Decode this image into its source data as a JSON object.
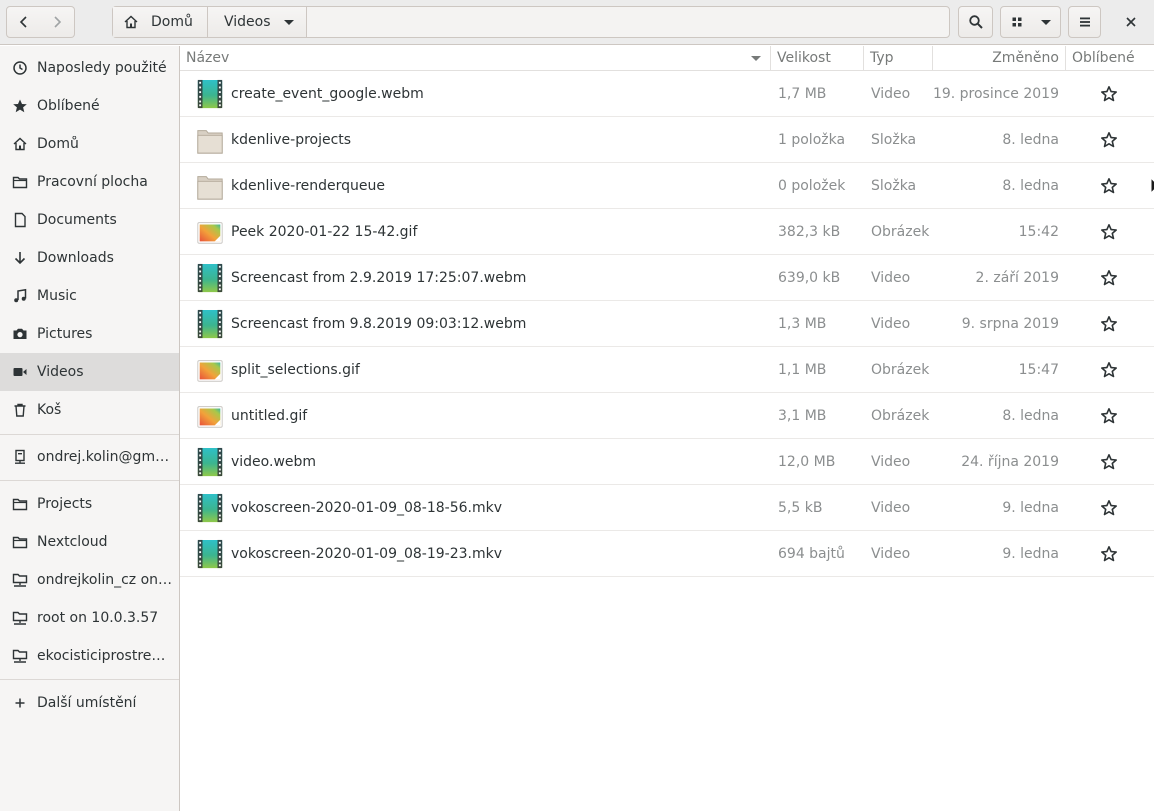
{
  "header": {
    "back_icon": "chevron-left-icon",
    "forward_icon": "chevron-right-icon",
    "breadcrumbs": [
      {
        "label": "Domů",
        "icon": "home-icon"
      },
      {
        "label": "Videos"
      }
    ],
    "search_icon": "search-icon",
    "view_icon": "grid-view-icon",
    "menu_icon": "hamburger-menu-icon",
    "close_icon": "close-icon"
  },
  "sidebar": {
    "items": [
      {
        "label": "Naposledy použité",
        "icon": "clock-icon"
      },
      {
        "label": "Oblíbené",
        "icon": "star-icon"
      },
      {
        "label": "Domů",
        "icon": "home-icon"
      },
      {
        "label": "Pracovní plocha",
        "icon": "folder-icon"
      },
      {
        "label": "Documents",
        "icon": "document-icon"
      },
      {
        "label": "Downloads",
        "icon": "download-icon"
      },
      {
        "label": "Music",
        "icon": "music-icon"
      },
      {
        "label": "Pictures",
        "icon": "camera-icon"
      },
      {
        "label": "Videos",
        "icon": "video-icon",
        "active": true
      },
      {
        "label": "Koš",
        "icon": "trash-icon"
      }
    ],
    "accounts": [
      {
        "label": "ondrej.kolin@gm…",
        "icon": "network-server-icon"
      }
    ],
    "bookmarks": [
      {
        "label": "Projects",
        "icon": "folder-icon"
      },
      {
        "label": "Nextcloud",
        "icon": "folder-icon"
      },
      {
        "label": "ondrejkolin_cz on…",
        "icon": "network-folder-icon"
      },
      {
        "label": "root on 10.0.3.57",
        "icon": "network-folder-icon"
      },
      {
        "label": "ekocisticiprostre…",
        "icon": "network-folder-icon"
      }
    ],
    "other_locations": {
      "label": "Další umístění",
      "icon": "plus-icon"
    }
  },
  "columns": {
    "name": "Název",
    "size": "Velikost",
    "type": "Typ",
    "modified": "Změněno",
    "favorite": "Oblíbené"
  },
  "files": [
    {
      "name": "create_event_google.webm",
      "size": "1,7 MB",
      "type": "Video",
      "modified": "19. prosince 2019",
      "icon": "video-file-icon"
    },
    {
      "name": "kdenlive-projects",
      "size": "1 položka",
      "type": "Složka",
      "modified": "8. ledna",
      "icon": "folder-icon"
    },
    {
      "name": "kdenlive-renderqueue",
      "size": "0 položek",
      "type": "Složka",
      "modified": "8. ledna",
      "icon": "folder-icon"
    },
    {
      "name": "Peek 2020-01-22 15-42.gif",
      "size": "382,3 kB",
      "type": "Obrázek",
      "modified": "15:42",
      "icon": "image-file-icon"
    },
    {
      "name": "Screencast from 2.9.2019 17:25:07.webm",
      "size": "639,0 kB",
      "type": "Video",
      "modified": "2. září 2019",
      "icon": "video-file-icon"
    },
    {
      "name": "Screencast from 9.8.2019 09:03:12.webm",
      "size": "1,3 MB",
      "type": "Video",
      "modified": "9. srpna 2019",
      "icon": "video-file-icon"
    },
    {
      "name": "split_selections.gif",
      "size": "1,1 MB",
      "type": "Obrázek",
      "modified": "15:47",
      "icon": "image-file-icon"
    },
    {
      "name": "untitled.gif",
      "size": "3,1 MB",
      "type": "Obrázek",
      "modified": "8. ledna",
      "icon": "image-file-icon"
    },
    {
      "name": "video.webm",
      "size": "12,0 MB",
      "type": "Video",
      "modified": "24. října 2019",
      "icon": "video-file-icon"
    },
    {
      "name": "vokoscreen-2020-01-09_08-18-56.mkv",
      "size": "5,5 kB",
      "type": "Video",
      "modified": "9. ledna",
      "icon": "video-file-icon"
    },
    {
      "name": "vokoscreen-2020-01-09_08-19-23.mkv",
      "size": "694 bajtů",
      "type": "Video",
      "modified": "9. ledna",
      "icon": "video-file-icon"
    }
  ]
}
